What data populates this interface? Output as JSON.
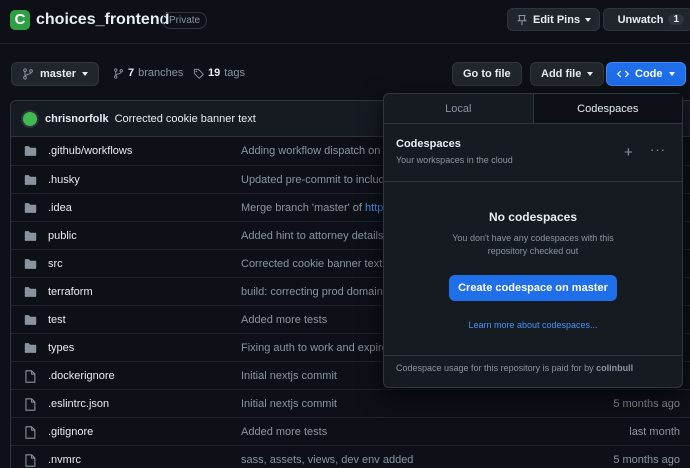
{
  "repo": {
    "logo": "C",
    "name": "choices_frontend",
    "visibility": "Private"
  },
  "header_actions": {
    "edit_pins": "Edit Pins",
    "unwatch": "Unwatch",
    "watch_count": "1"
  },
  "toolbar": {
    "branch": "master",
    "branches_count": "7",
    "branches_label": "branches",
    "tags_count": "19",
    "tags_label": "tags",
    "go_to_file": "Go to file",
    "add_file": "Add file",
    "code": "Code"
  },
  "latest_commit": {
    "author": "chrisnorfolk",
    "message": "Corrected cookie banner text"
  },
  "files": [
    {
      "type": "dir",
      "name": ".github/workflows",
      "message": "Adding workflow dispatch on",
      "time": ""
    },
    {
      "type": "dir",
      "name": ".husky",
      "message": "Updated pre-commit to includ",
      "time": ""
    },
    {
      "type": "dir",
      "name": ".idea",
      "message": "Merge branch 'master' of ",
      "message_link": "http",
      "time": ""
    },
    {
      "type": "dir",
      "name": "public",
      "message": "Added hint to attorney details",
      "time": ""
    },
    {
      "type": "dir",
      "name": "src",
      "message": "Corrected cookie banner text",
      "time": ""
    },
    {
      "type": "dir",
      "name": "terraform",
      "message": "build: correcting prod domain",
      "time": ""
    },
    {
      "type": "dir",
      "name": "test",
      "message": "Added more tests",
      "time": ""
    },
    {
      "type": "dir",
      "name": "types",
      "message": "Fixing auth to work and expire",
      "time": ""
    },
    {
      "type": "file",
      "name": ".dockerignore",
      "message": "Initial nextjs commit",
      "time": ""
    },
    {
      "type": "file",
      "name": ".eslintrc.json",
      "message": "Initial nextjs commit",
      "time": "5 months ago"
    },
    {
      "type": "file",
      "name": ".gitignore",
      "message": "Added more tests",
      "time": "last month"
    },
    {
      "type": "file",
      "name": ".nvmrc",
      "message": "sass, assets, views, dev env added",
      "time": "5 months ago"
    }
  ],
  "code_dropdown": {
    "tab_local": "Local",
    "tab_codespaces": "Codespaces",
    "title": "Codespaces",
    "subtitle": "Your workspaces in the cloud",
    "empty_title": "No codespaces",
    "empty_desc": "You don't have any codespaces with this repository checked out",
    "create_button": "Create codespace on master",
    "learn_more": "Learn more about codespaces...",
    "footer_text": "Codespace usage for this repository is paid for by ",
    "footer_user": "colinbull"
  },
  "colors": {
    "background": "#0d1117",
    "accent": "#1f6feb",
    "logo": "#2ea043",
    "link": "#4493f8"
  }
}
